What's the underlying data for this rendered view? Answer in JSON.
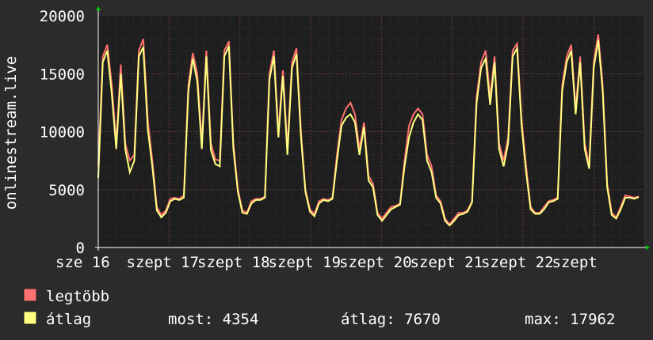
{
  "chart_data": {
    "type": "line",
    "ylabel": "onlinestream.live",
    "ylim": [
      0,
      20000
    ],
    "y_ticks": [
      0,
      5000,
      10000,
      15000,
      20000
    ],
    "x_tick_labels": [
      "sze 16",
      "szept 17",
      "szept 18",
      "szept 19",
      "szept 20",
      "szept 21",
      "szept 22",
      "szept"
    ],
    "colors": {
      "background": "#2b2b2b",
      "plot_bg": "#1e1e1e",
      "max": "#ff7070",
      "avg": "#ffff80",
      "grid": "#3a3a3a"
    },
    "series": [
      {
        "name": "legtöbb",
        "values": [
          7000,
          16500,
          17500,
          14000,
          9000,
          15800,
          9000,
          7500,
          8000,
          17000,
          18000,
          11000,
          7500,
          3500,
          2800,
          3200,
          4200,
          4300,
          4200,
          4500,
          14000,
          16800,
          15000,
          9000,
          17000,
          9000,
          7600,
          7500,
          17000,
          17800,
          9000,
          5000,
          3200,
          3000,
          4000,
          4200,
          4200,
          4400,
          15000,
          17000,
          10000,
          15300,
          8500,
          16000,
          17200,
          10000,
          5000,
          3300,
          2900,
          4000,
          4200,
          4100,
          4300,
          8000,
          11000,
          12000,
          12500,
          11500,
          8500,
          10800,
          6200,
          5500,
          3000,
          2500,
          3000,
          3500,
          3600,
          3800,
          7500,
          10500,
          11500,
          12000,
          11500,
          8000,
          7000,
          4500,
          4000,
          2500,
          2000,
          2500,
          3000,
          3000,
          3200,
          4000,
          13000,
          16000,
          17000,
          13000,
          16500,
          9000,
          7500,
          9500,
          17000,
          17600,
          11000,
          7000,
          3500,
          3000,
          3000,
          3500,
          4000,
          4100,
          4300,
          14000,
          16500,
          17500,
          12000,
          16500,
          9000,
          7200,
          16000,
          18400,
          14000,
          5500,
          3000,
          2600,
          3500,
          4500,
          4400,
          4300,
          4400
        ]
      },
      {
        "name": "átlag",
        "values": [
          6000,
          16000,
          17000,
          13200,
          8500,
          15000,
          8500,
          6500,
          7500,
          16500,
          17300,
          10200,
          7000,
          3200,
          2600,
          3000,
          4000,
          4200,
          4100,
          4300,
          13500,
          16300,
          14300,
          8500,
          16500,
          8400,
          7200,
          7000,
          16500,
          17400,
          8500,
          4800,
          3000,
          2900,
          3800,
          4100,
          4100,
          4300,
          14500,
          16500,
          9500,
          14800,
          8000,
          15500,
          16700,
          9500,
          4800,
          3100,
          2700,
          3800,
          4100,
          4000,
          4200,
          7500,
          10500,
          11200,
          11500,
          10800,
          8000,
          10400,
          5800,
          5200,
          2800,
          2300,
          2800,
          3300,
          3500,
          3700,
          7000,
          9500,
          10800,
          11500,
          11000,
          7500,
          6500,
          4300,
          3800,
          2300,
          1900,
          2300,
          2800,
          2900,
          3100,
          3900,
          12500,
          15500,
          16300,
          12300,
          16000,
          8500,
          7000,
          9000,
          16500,
          17200,
          10500,
          6500,
          3300,
          2900,
          2900,
          3300,
          3900,
          4000,
          4200,
          13500,
          16000,
          17000,
          11500,
          16000,
          8500,
          6800,
          15500,
          17900,
          13500,
          5200,
          2800,
          2500,
          3300,
          4300,
          4300,
          4200,
          4354
        ]
      }
    ],
    "legend": [
      {
        "name": "legtöbb",
        "color": "#ff7070"
      },
      {
        "name": "átlag",
        "color": "#ffff80"
      }
    ],
    "stats": {
      "current": "most: 4354",
      "average": "átlag: 7670",
      "max": "max: 17962"
    },
    "legend_placement": "bottom-left",
    "grid": true
  }
}
